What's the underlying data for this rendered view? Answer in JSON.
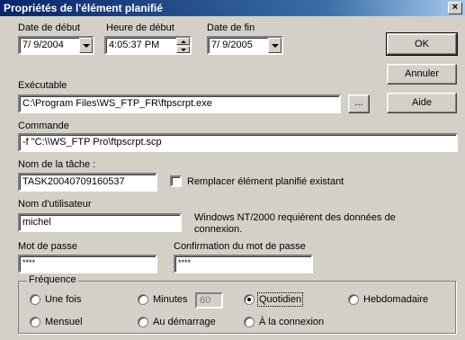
{
  "window": {
    "title": "Propriétés de l'élément planifié",
    "close_glyph": "×"
  },
  "start_date": {
    "label": "Date de début",
    "value": "7/ 9/2004"
  },
  "start_time": {
    "label": "Heure de début",
    "value": "4:05:37 PM"
  },
  "end_date": {
    "label": "Date de fin",
    "value": "7/ 9/2005"
  },
  "executable": {
    "label": "Exécutable",
    "value": "C:\\Program Files\\WS_FTP_FR\\ftpscrpt.exe",
    "browse_label": "..."
  },
  "command": {
    "label": "Commande",
    "value": "-f \"C:\\\\WS_FTP Pro\\ftpscrpt.scp"
  },
  "task_name": {
    "label": "Nom de la tâche :",
    "value": "TASK20040709160537"
  },
  "replace": {
    "label": "Remplacer élément planifié existant"
  },
  "username": {
    "label": "Nom d'utilisateur",
    "value": "michel",
    "note": "Windows NT/2000 requièrent des données de connexion."
  },
  "password": {
    "label": "Mot de passe",
    "value": "****"
  },
  "confirm_password": {
    "label": "Confirmation du mot de passe",
    "value": "****"
  },
  "buttons": {
    "ok": "OK",
    "cancel": "Annuler",
    "help": "Aide"
  },
  "frequency": {
    "label": "Fréquence",
    "options": {
      "once": "Une fois",
      "minutes": "Minutes",
      "minutes_value": "60",
      "daily": "Quotidien",
      "weekly": "Hebdomadaire",
      "monthly": "Mensuel",
      "startup": "Au démarrage",
      "logon": "À la connexion"
    },
    "selected": "Quotidien"
  }
}
